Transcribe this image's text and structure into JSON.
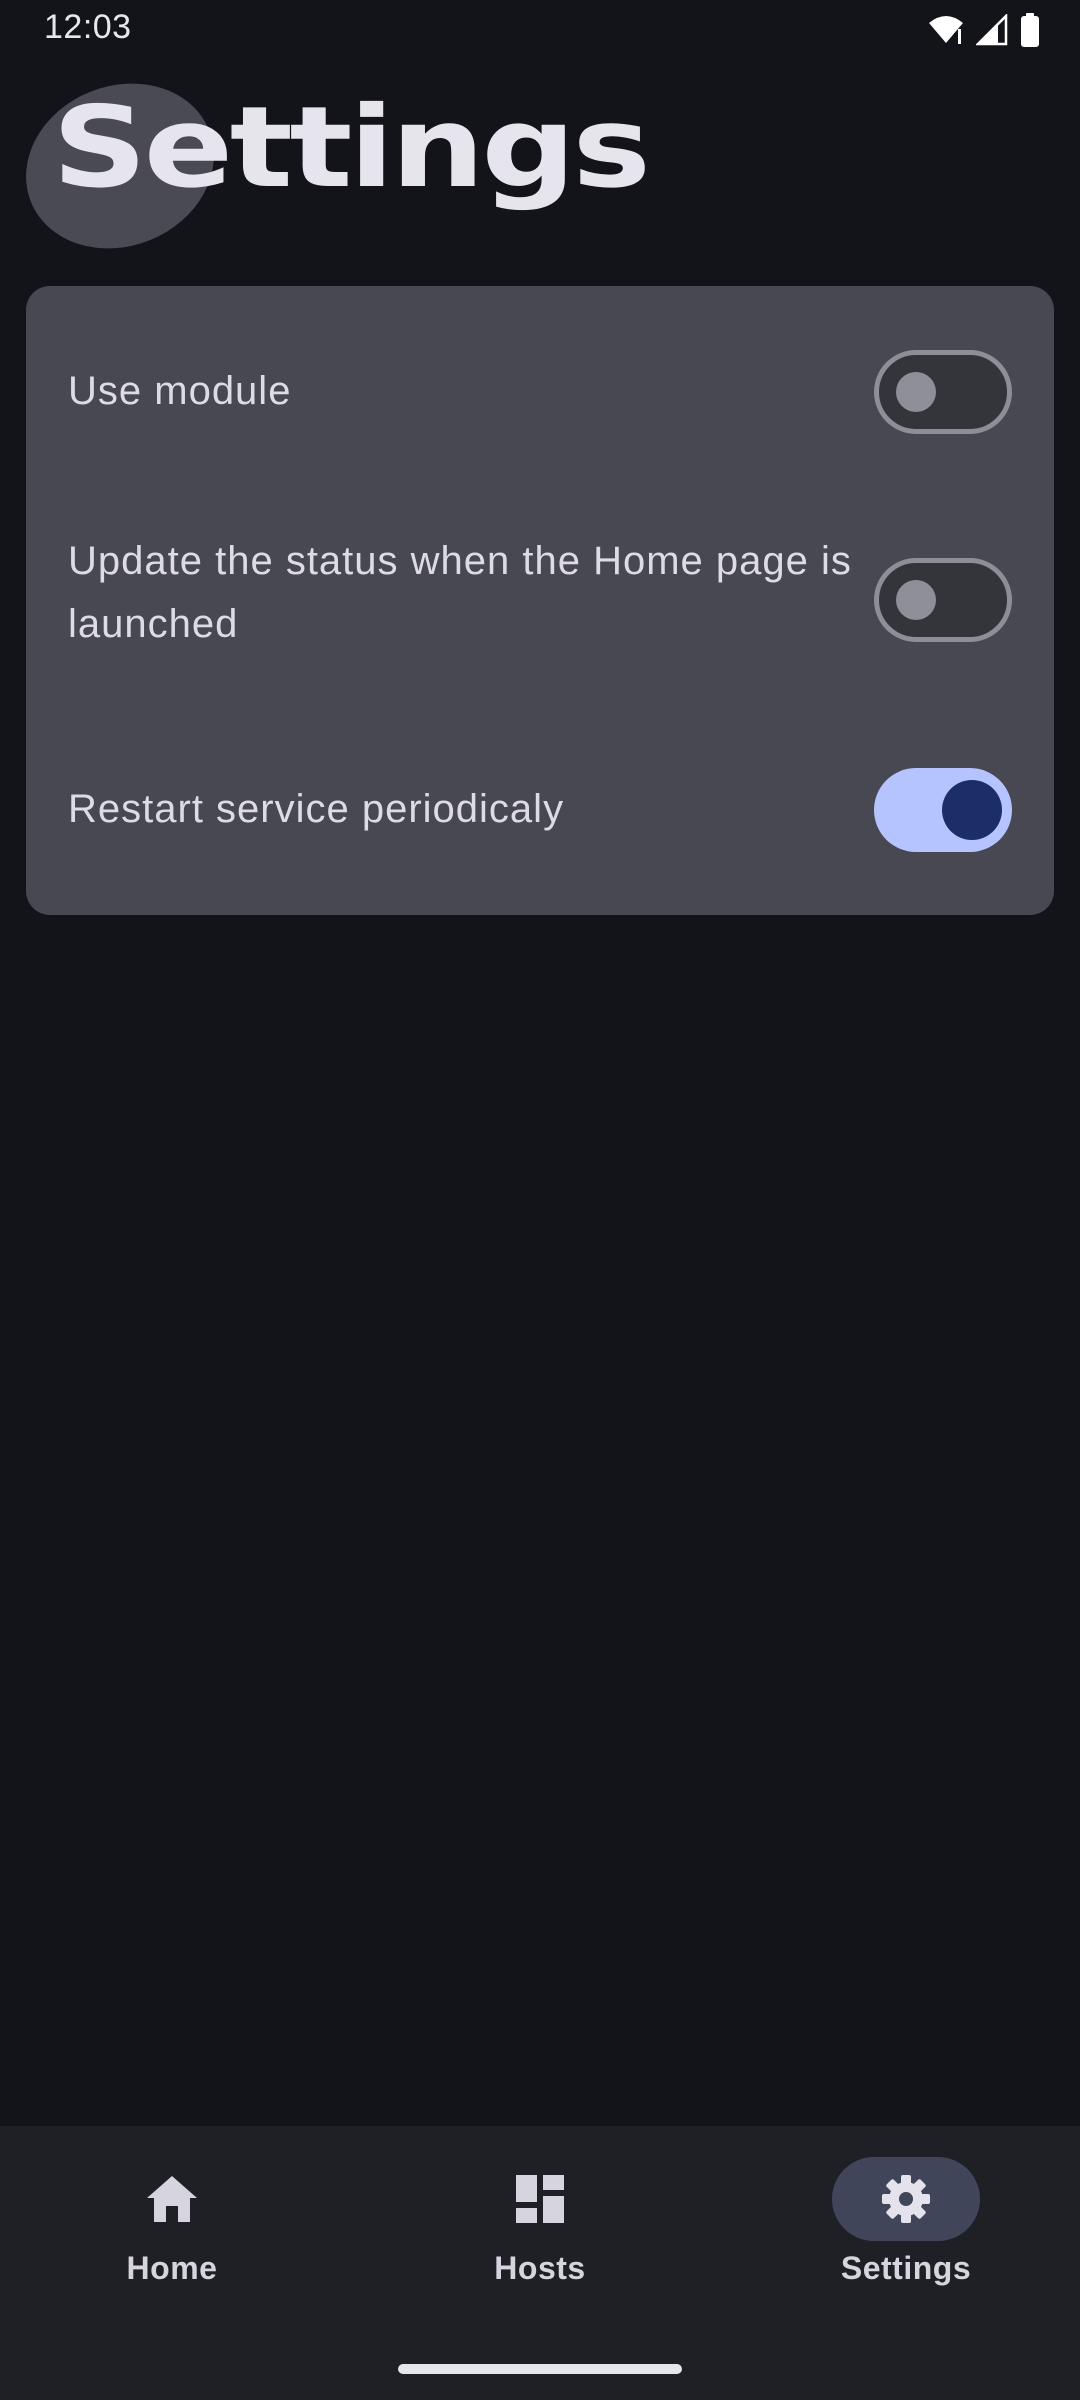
{
  "status_bar": {
    "time": "12:03",
    "icons": [
      "wifi-icon",
      "signal-icon",
      "battery-icon"
    ]
  },
  "page": {
    "title": "Settings"
  },
  "settings": [
    {
      "label": "Use module",
      "enabled": false
    },
    {
      "label": "Update the status when the Home page is launched",
      "enabled": false
    },
    {
      "label": "Restart service periodicaly",
      "enabled": true
    }
  ],
  "bottom_nav": {
    "items": [
      {
        "label": "Home",
        "icon": "home-icon",
        "active": false
      },
      {
        "label": "Hosts",
        "icon": "dashboard-icon",
        "active": false
      },
      {
        "label": "Settings",
        "icon": "gear-icon",
        "active": true
      }
    ]
  },
  "colors": {
    "background": "#131419",
    "card": "#484853",
    "switch_on_track": "#b5c4ff",
    "switch_on_knob": "#1c2e66",
    "nav_background": "#1f2026",
    "nav_active_pill": "#40455a"
  }
}
